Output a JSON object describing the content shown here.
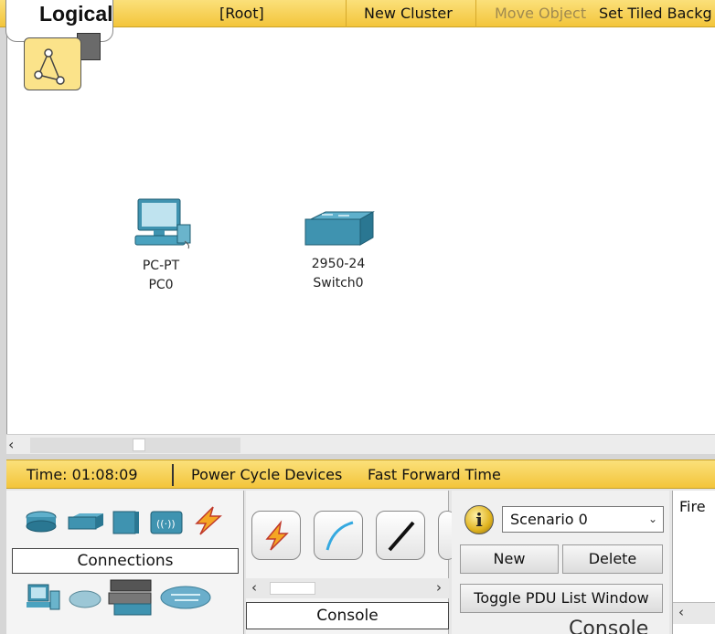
{
  "toolbar": {
    "logical_label": "Logical",
    "root": "[Root]",
    "new_cluster": "New Cluster",
    "move_object": "Move Object",
    "set_tiled_background": "Set Tiled Backg"
  },
  "workspace": {
    "devices": [
      {
        "model": "PC-PT",
        "name": "PC0",
        "icon": "pc-icon"
      },
      {
        "model": "2950-24",
        "name": "Switch0",
        "icon": "switch-icon"
      }
    ]
  },
  "timebar": {
    "time": "Time: 01:08:09",
    "power_cycle": "Power Cycle Devices",
    "fast_forward": "Fast Forward Time"
  },
  "device_panel": {
    "category_icons": [
      "router-icon",
      "switch-icon",
      "hub-icon",
      "wireless-icon",
      "connections-icon"
    ],
    "sub_icons": [
      "end-device-icon",
      "wan-cloud-icon",
      "multiuser-icon",
      "custom-cloud-icon"
    ],
    "selected_category": "Connections"
  },
  "connection_panel": {
    "types": [
      "auto-connect-icon",
      "console-cable-icon",
      "straight-through-icon"
    ],
    "selected_type": "Console"
  },
  "scenario_panel": {
    "scenario": "Scenario 0",
    "new_label": "New",
    "delete_label": "Delete",
    "toggle_pdu": "Toggle PDU List Window"
  },
  "fire_panel": {
    "fire_label": "Fire"
  },
  "behind_text": "Console",
  "colors": {
    "toolbar_yellow": "#f3c53b",
    "workspace": "#ffffff",
    "device_teal": "#3f93b0"
  }
}
